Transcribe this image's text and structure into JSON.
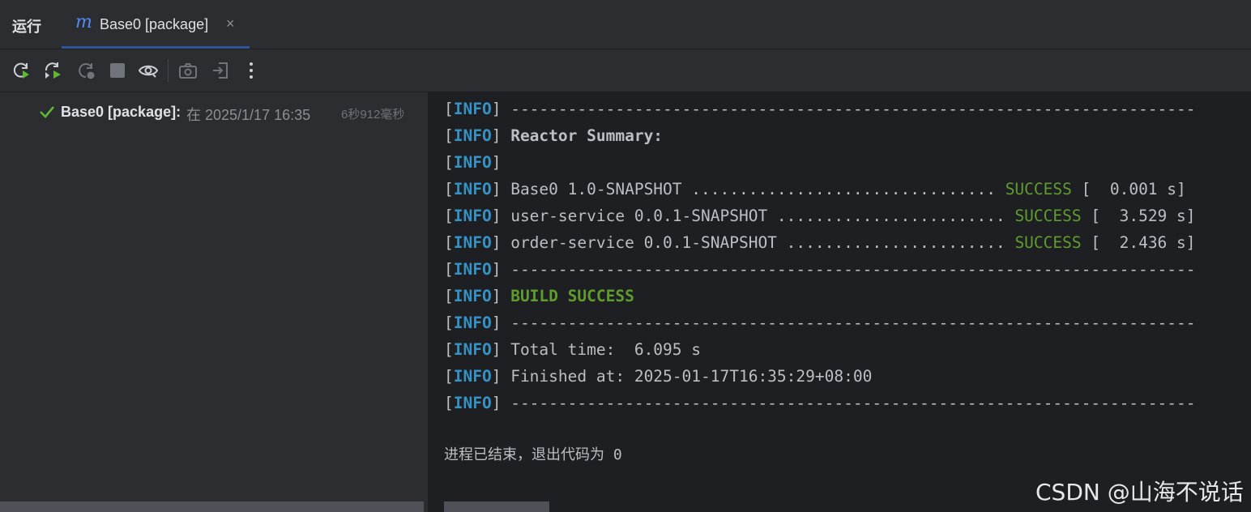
{
  "header": {
    "run_title": "运行",
    "tab": {
      "icon": "m",
      "label": "Base0 [package]",
      "close": "×"
    }
  },
  "toolbar": {
    "icons": [
      "rerun-icon",
      "rerun-failed-icon",
      "restart-icon",
      "stop-icon",
      "eye-icon",
      "camera-icon",
      "exit-icon",
      "more-icon"
    ],
    "more_glyph": "⋮"
  },
  "tree": {
    "item_name": "Base0 [package]:",
    "item_time": "在 2025/1/17 16:35",
    "item_duration": "6秒912毫秒"
  },
  "console": {
    "lines": [
      {
        "tag": "INFO",
        "text": "------------------------------------------------------------------------"
      },
      {
        "tag": "INFO",
        "text": "Reactor Summary:"
      },
      {
        "tag": "INFO",
        "text": ""
      },
      {
        "tag": "INFO",
        "text": "Base0 1.0-SNAPSHOT ................................ ",
        "status": "SUCCESS",
        "time": "[  0.001 s]"
      },
      {
        "tag": "INFO",
        "text": "user-service 0.0.1-SNAPSHOT ........................ ",
        "status": "SUCCESS",
        "time": "[  3.529 s]"
      },
      {
        "tag": "INFO",
        "text": "order-service 0.0.1-SNAPSHOT ....................... ",
        "status": "SUCCESS",
        "time": "[  2.436 s]"
      },
      {
        "tag": "INFO",
        "text": "------------------------------------------------------------------------"
      },
      {
        "tag": "INFO",
        "text": "BUILD SUCCESS"
      },
      {
        "tag": "INFO",
        "text": "------------------------------------------------------------------------"
      },
      {
        "tag": "INFO",
        "text": "Total time:  6.095 s"
      },
      {
        "tag": "INFO",
        "text": "Finished at: 2025-01-17T16:35:29+08:00"
      },
      {
        "tag": "INFO",
        "text": "------------------------------------------------------------------------"
      }
    ],
    "exit_message": "进程已结束，退出代码为 0"
  },
  "watermark": "CSDN @山海不说话",
  "colors": {
    "info": "#3592c4",
    "success": "#5e9c2e",
    "background": "#1e1f22",
    "panel": "#2b2d30"
  }
}
